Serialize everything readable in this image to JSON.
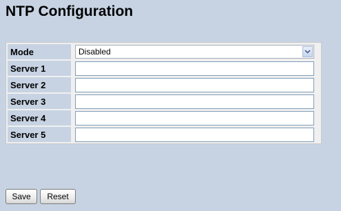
{
  "page": {
    "title": "NTP Configuration"
  },
  "mode": {
    "label": "Mode",
    "selected": "Disabled"
  },
  "servers": [
    {
      "label": "Server 1",
      "value": ""
    },
    {
      "label": "Server 2",
      "value": ""
    },
    {
      "label": "Server 3",
      "value": ""
    },
    {
      "label": "Server 4",
      "value": ""
    },
    {
      "label": "Server 5",
      "value": ""
    }
  ],
  "buttons": {
    "save": "Save",
    "reset": "Reset"
  },
  "colors": {
    "background": "#c7d3e3",
    "table_background": "#f0f0f0"
  },
  "icons": {
    "dropdown": "chevron-down-icon"
  }
}
